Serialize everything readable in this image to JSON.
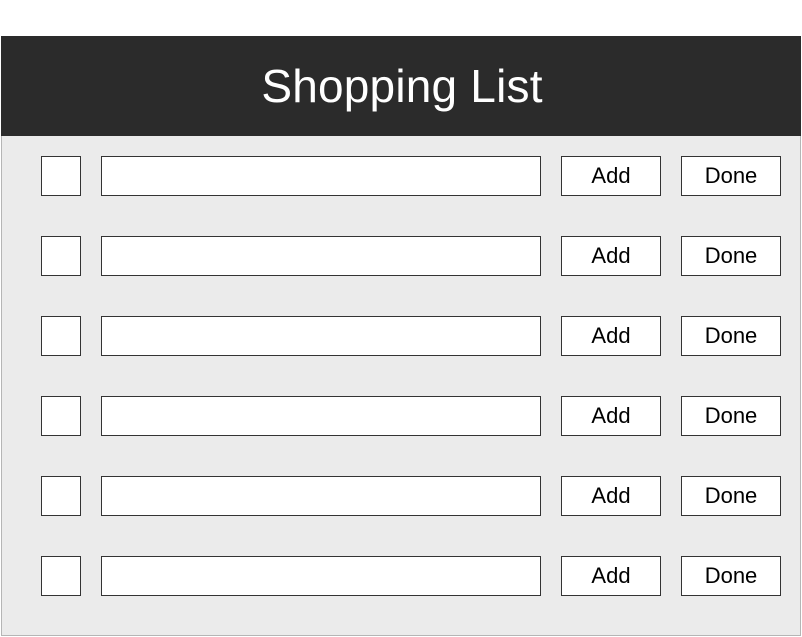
{
  "header": {
    "title": "Shopping List",
    "background": "#2b2b2b",
    "text_color": "#ffffff"
  },
  "list": {
    "background": "#ebebeb",
    "rows": [
      {
        "checked": false,
        "item_value": "",
        "add_label": "Add",
        "done_label": "Done"
      },
      {
        "checked": false,
        "item_value": "",
        "add_label": "Add",
        "done_label": "Done"
      },
      {
        "checked": false,
        "item_value": "",
        "add_label": "Add",
        "done_label": "Done"
      },
      {
        "checked": false,
        "item_value": "",
        "add_label": "Add",
        "done_label": "Done"
      },
      {
        "checked": false,
        "item_value": "",
        "add_label": "Add",
        "done_label": "Done"
      },
      {
        "checked": false,
        "item_value": "",
        "add_label": "Add",
        "done_label": "Done"
      }
    ]
  }
}
